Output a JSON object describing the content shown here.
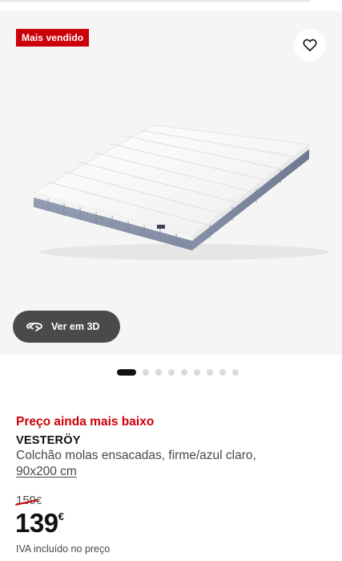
{
  "gallery": {
    "badge": "Mais vendido",
    "favorite_icon": "heart-outline-icon",
    "view_3d": {
      "label": "Ver em 3D",
      "icon": "rotate-3d-icon"
    },
    "dots_total": 9,
    "dots_active_index": 0
  },
  "product": {
    "promo_label": "Preço ainda mais baixo",
    "name": "VESTERÖY",
    "description": "Colchão molas ensacadas, firme/azul claro,",
    "size": "90x200 cm"
  },
  "price": {
    "old_value": "159",
    "old_currency": "€",
    "value": "139",
    "currency": "€",
    "vat_note": "IVA incluído no preço"
  },
  "colors": {
    "accent_red": "#cc0008",
    "button_dark": "#4a4a4a",
    "mattress_blue": "#8a95ab"
  }
}
